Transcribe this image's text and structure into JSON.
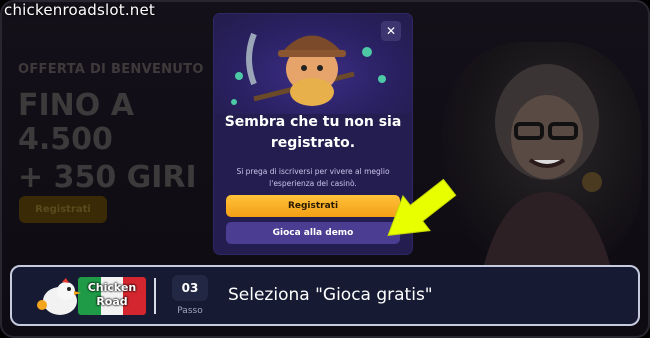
{
  "watermark": "chickenroadslot.net",
  "promo": {
    "label": "OFFERTA DI BENVENUTO",
    "line1": "FINO A 4.500",
    "line2": "+ 350 GIRI",
    "button": "Registrati"
  },
  "modal": {
    "title": "Sembra che tu non sia registrato.",
    "description": "Si prega di iscriversi per vivere al meglio l'esperienza del casinò.",
    "register_button": "Registrati",
    "demo_button": "Gioca alla demo",
    "close_icon": "close-icon"
  },
  "bottom_bar": {
    "logo_text": "Chicken Road",
    "step_number": "03",
    "step_label": "Passo",
    "instruction": "Seleziona \"Gioca gratis\""
  },
  "colors": {
    "modal_bg": "#241d4f",
    "register_button": "#f7ad21",
    "demo_button": "#4a3d92",
    "arrow": "#e8ff00",
    "bottom_bar_bg": "#161b33"
  }
}
